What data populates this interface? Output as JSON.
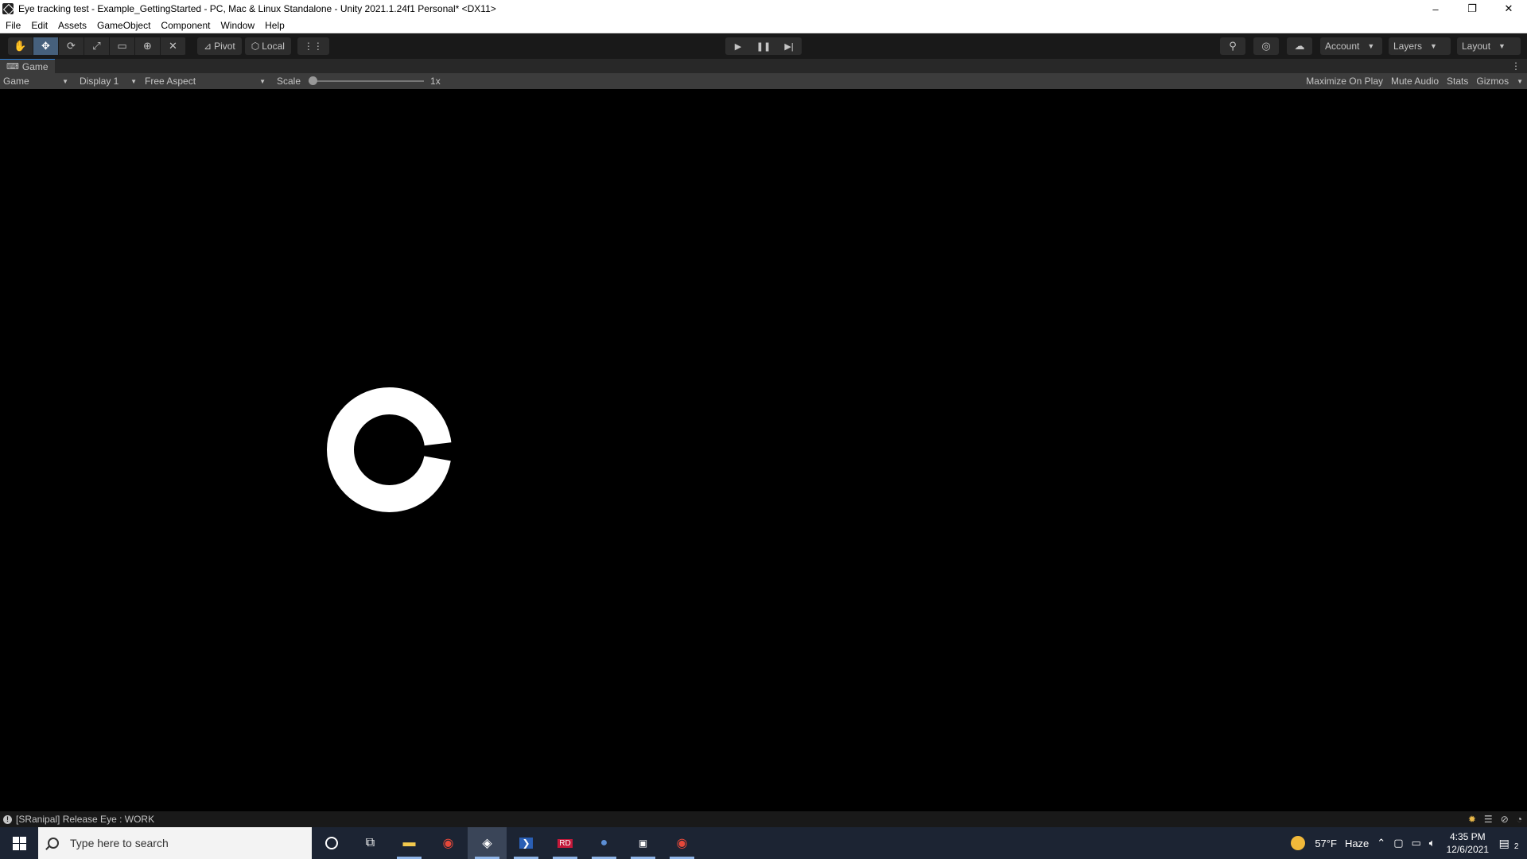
{
  "window": {
    "title": "Eye tracking test - Example_GettingStarted - PC, Mac & Linux Standalone - Unity 2021.1.24f1 Personal* <DX11>",
    "minimize": "–",
    "restore": "❐",
    "close": "✕"
  },
  "menu": [
    "File",
    "Edit",
    "Assets",
    "GameObject",
    "Component",
    "Window",
    "Help"
  ],
  "toolbar": {
    "tools": [
      "✋",
      "✥",
      "⟳",
      "⤢",
      "▭",
      "⊕",
      "✕"
    ],
    "pivot_label": "Pivot",
    "local_label": "Local",
    "grid_snap": "⋮⋮",
    "play": "▶",
    "pause": "❚❚",
    "step": "▶|",
    "search_icon": "⚲",
    "collab_icon": "◎",
    "cloud_icon": "☁",
    "account_label": "Account",
    "layers_label": "Layers",
    "layout_label": "Layout"
  },
  "tab": {
    "label": "Game",
    "more": "⋮"
  },
  "game_bar": {
    "view_mode": "Game",
    "display": "Display 1",
    "aspect": "Free Aspect",
    "scale_label": "Scale",
    "scale_value": "1x",
    "scale_fraction": 0.0,
    "maximize_on_play": "Maximize On Play",
    "mute_audio": "Mute Audio",
    "stats": "Stats",
    "gizmos": "Gizmos"
  },
  "status": {
    "message": "[SRanipal] Release Eye : WORK"
  },
  "taskbar": {
    "search_placeholder": "Type here to search",
    "weather_temp": "57°F",
    "weather_desc": "Haze",
    "time": "4:35 PM",
    "date": "12/6/2021",
    "notification_count": "2"
  },
  "colors": {
    "toolbar_bg": "#191919",
    "panel_bg": "#3c3c3c",
    "taskbar_bg": "#1c2433",
    "accent": "#2f7fd4"
  }
}
